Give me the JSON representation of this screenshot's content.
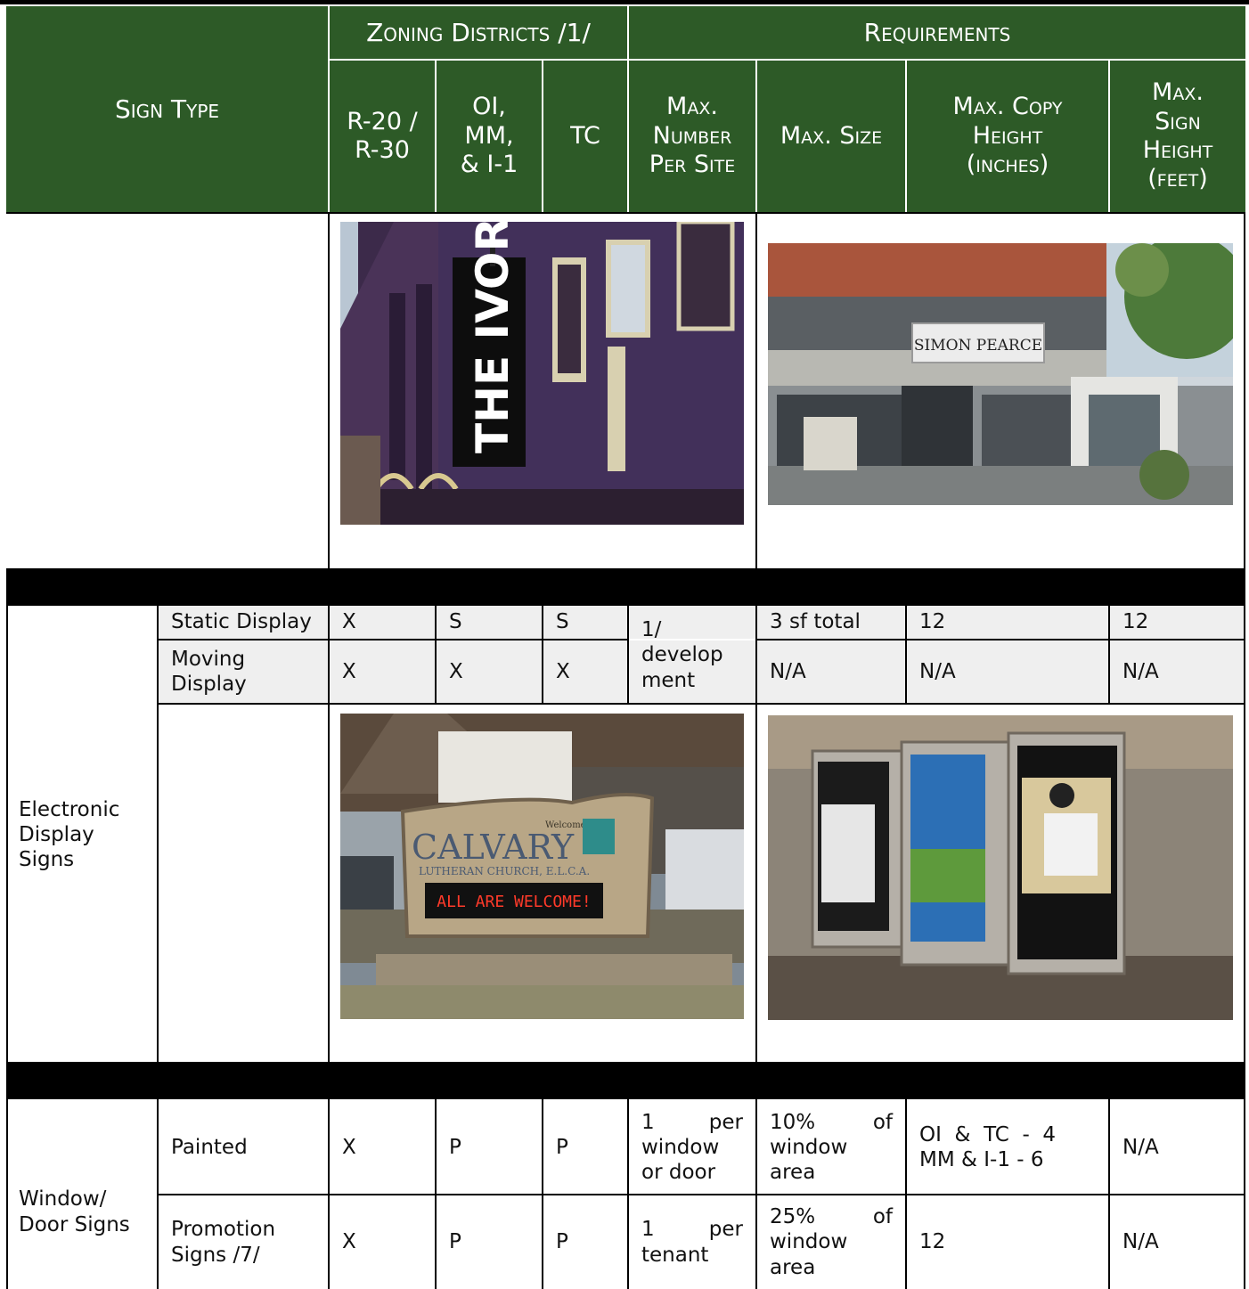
{
  "header": {
    "sign_type": "Sign Type",
    "zoning_group": "Zoning Districts /1/",
    "requirements_group": "Requirements",
    "col_r20_line1": "R-20 /",
    "col_r20_line2": "R-30",
    "col_oi_line1": "OI,",
    "col_oi_line2": "MM,",
    "col_oi_line3": "& I-1",
    "col_tc": "TC",
    "col_maxnum_line1": "Max.",
    "col_maxnum_line2": "Number",
    "col_maxnum_line3": "Per Site",
    "col_maxsize": "Max. Size",
    "col_copy_line1": "Max. Copy",
    "col_copy_line2": "Height",
    "col_copy_line3": "(inches)",
    "col_signh_line1": "Max.",
    "col_signh_line2": "Sign",
    "col_signh_line3": "Height",
    "col_signh_line4": "(feet)"
  },
  "photos": {
    "ivory_text": "THE IVORY",
    "simon_text": "SIMON PEARCE",
    "calvary_welcome": "Welcome to",
    "calvary_name": "CALVARY",
    "calvary_sub": "LUTHERAN CHURCH, E.L.C.A.",
    "calvary_led": "ALL ARE WELCOME!"
  },
  "electronic": {
    "category_line1": "Electronic",
    "category_line2": "Display",
    "category_line3": "Signs",
    "rows": [
      {
        "type_line1": "Static Display",
        "type_line2": "",
        "r20": "X",
        "oi": "S",
        "tc": "S",
        "size": "3 sf total",
        "copy": "12",
        "height": "12"
      },
      {
        "type_line1": "Moving",
        "type_line2": "Display",
        "r20": "X",
        "oi": "X",
        "tc": "X",
        "size": "N/A",
        "copy": "N/A",
        "height": "N/A"
      }
    ],
    "max_number_line1": "1/",
    "max_number_line2": "develop",
    "max_number_line3": "ment"
  },
  "window": {
    "category_line1": "Window/",
    "category_line2": "Door Signs",
    "rows": [
      {
        "type_line1": "Painted",
        "type_line2": "",
        "r20": "X",
        "oi": "P",
        "tc": "P",
        "num_line1a": "1",
        "num_line1b": "per",
        "num_line2": "window",
        "num_line3": "or door",
        "size_line1a": "10%",
        "size_line1b": "of",
        "size_line2": "window",
        "size_line3": "area",
        "copy_line1": "OI  &  TC  -  4",
        "copy_line2": "MM & I-1 - 6",
        "height": "N/A"
      },
      {
        "type_line1": "Promotion",
        "type_line2": "Signs /7/",
        "r20": "X",
        "oi": "P",
        "tc": "P",
        "num_line1a": "1",
        "num_line1b": "per",
        "num_line2": "tenant",
        "num_line3": "",
        "size_line1a": "25%",
        "size_line1b": "of",
        "size_line2": "window",
        "size_line3": "area",
        "copy_line1": "12",
        "copy_line2": "",
        "height": "N/A"
      }
    ]
  },
  "colors": {
    "header_green": "#2d5a27",
    "row_gray": "#efefef",
    "band_black": "#000000"
  }
}
